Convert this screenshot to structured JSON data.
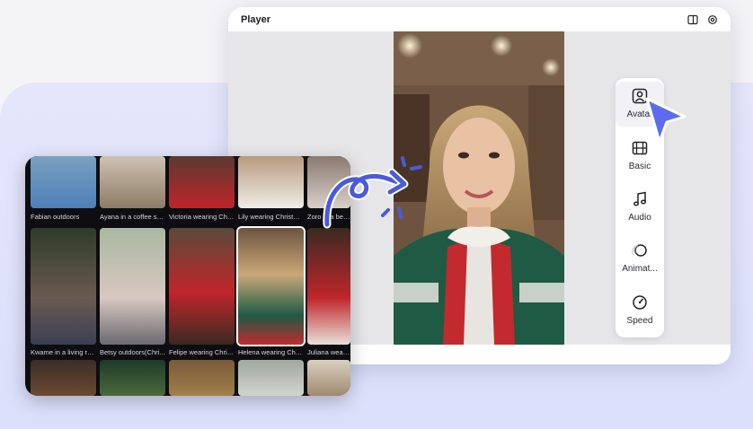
{
  "player": {
    "title": "Player",
    "icons": [
      "panel-icon",
      "settings-icon"
    ]
  },
  "toolbar": {
    "items": [
      {
        "label": "Avatar",
        "icon": "avatar-icon",
        "active": true
      },
      {
        "label": "Basic",
        "icon": "film-icon"
      },
      {
        "label": "Audio",
        "icon": "music-note-icon"
      },
      {
        "label": "Animat...",
        "icon": "animation-icon"
      },
      {
        "label": "Speed",
        "icon": "speedometer-icon"
      }
    ]
  },
  "gallery": {
    "row1": [
      "Fabian outdoors",
      "Ayana in a coffee sh...",
      "Victoria wearing Chris...",
      "Lily wearing Christm...",
      "Zoro in a bed..."
    ],
    "row2": [
      "Kwame in a living ro...",
      "Betsy outdoors(Chri...",
      "Felipe wearing Christ...",
      "Helena wearing Chris...",
      "Juliana wearin..."
    ],
    "selected_index": 3
  },
  "colors": {
    "accent": "#5b6cf0",
    "backdrop": "#dfe1fb"
  }
}
